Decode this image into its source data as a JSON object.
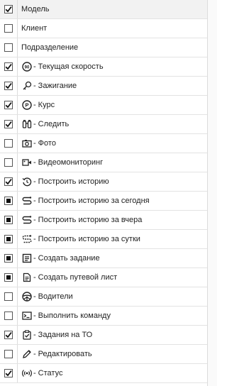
{
  "rows": [
    {
      "label": "Модель",
      "state": "checked",
      "icon": null,
      "header": true
    },
    {
      "label": "Клиент",
      "state": "unchecked",
      "icon": null
    },
    {
      "label": "Подразделение",
      "state": "unchecked",
      "icon": null
    },
    {
      "label": "Текущая скорость",
      "state": "checked",
      "icon": "speedometer-icon"
    },
    {
      "label": "Зажигание",
      "state": "checked",
      "icon": "key-icon"
    },
    {
      "label": "Курс",
      "state": "checked",
      "icon": "compass-p-icon"
    },
    {
      "label": "Следить",
      "state": "checked",
      "icon": "binoculars-icon"
    },
    {
      "label": "Фото",
      "state": "unchecked",
      "icon": "camera-icon"
    },
    {
      "label": "Видеомониторинг",
      "state": "unchecked",
      "icon": "video-camera-icon"
    },
    {
      "label": "Построить историю",
      "state": "checked",
      "icon": "history-icon"
    },
    {
      "label": "Построить историю за сегодня",
      "state": "indeterminate",
      "icon": "route-icon"
    },
    {
      "label": "Построить историю за вчера",
      "state": "indeterminate",
      "icon": "route-icon"
    },
    {
      "label": "Построить историю за сутки",
      "state": "indeterminate",
      "icon": "route-dotted-icon"
    },
    {
      "label": "Создать задание",
      "state": "indeterminate",
      "icon": "task-icon"
    },
    {
      "label": "Создать путевой лист",
      "state": "indeterminate",
      "icon": "document-icon"
    },
    {
      "label": "Водители",
      "state": "unchecked",
      "icon": "steering-wheel-icon"
    },
    {
      "label": "Выполнить команду",
      "state": "unchecked",
      "icon": "terminal-icon"
    },
    {
      "label": "Задания на ТО",
      "state": "checked",
      "icon": "clipboard-check-icon"
    },
    {
      "label": "Редактировать",
      "state": "unchecked",
      "icon": "pencil-icon"
    },
    {
      "label": "Статус",
      "state": "checked",
      "icon": "signal-icon"
    }
  ]
}
